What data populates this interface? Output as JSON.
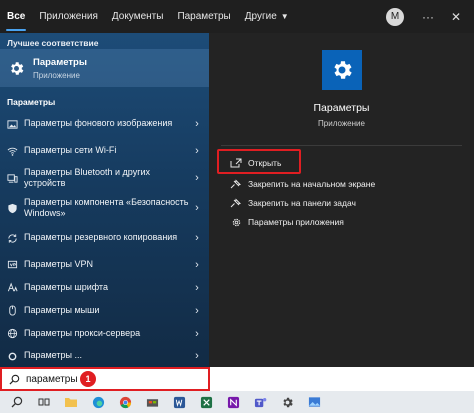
{
  "tabs": [
    {
      "label": "Все"
    },
    {
      "label": "Приложения"
    },
    {
      "label": "Документы"
    },
    {
      "label": "Параметры"
    },
    {
      "label": "Другие"
    }
  ],
  "account_initial": "M",
  "best_match": {
    "heading": "Лучшее соответствие",
    "title": "Параметры",
    "subtitle": "Приложение"
  },
  "settings_section": {
    "heading": "Параметры",
    "items": [
      {
        "label": "Параметры фонового изображения",
        "icon": "image-icon"
      },
      {
        "label": "Параметры сети Wi-Fi",
        "icon": "wifi-icon"
      },
      {
        "label": "Параметры Bluetooth и других устройств",
        "icon": "devices-icon"
      },
      {
        "label": "Параметры компонента «Безопасность Windows»",
        "icon": "shield-icon"
      },
      {
        "label": "Параметры резервного копирования",
        "icon": "sync-icon"
      },
      {
        "label": "Параметры VPN",
        "icon": "vpn-icon"
      },
      {
        "label": "Параметры шрифта",
        "icon": "font-icon"
      },
      {
        "label": "Параметры мыши",
        "icon": "mouse-icon"
      },
      {
        "label": "Параметры прокси-сервера",
        "icon": "globe-icon"
      },
      {
        "label": "Параметры ...",
        "icon": "gear-icon"
      }
    ]
  },
  "preview": {
    "title": "Параметры",
    "subtitle": "Приложение",
    "actions": [
      {
        "label": "Открыть"
      },
      {
        "label": "Закрепить на начальном экране"
      },
      {
        "label": "Закрепить на панели задач"
      },
      {
        "label": "Параметры приложения"
      }
    ]
  },
  "search": {
    "value": "параметры",
    "step_badge": "1"
  },
  "colors": {
    "accent": "#0a63b8",
    "highlight_red": "#e01e22"
  }
}
